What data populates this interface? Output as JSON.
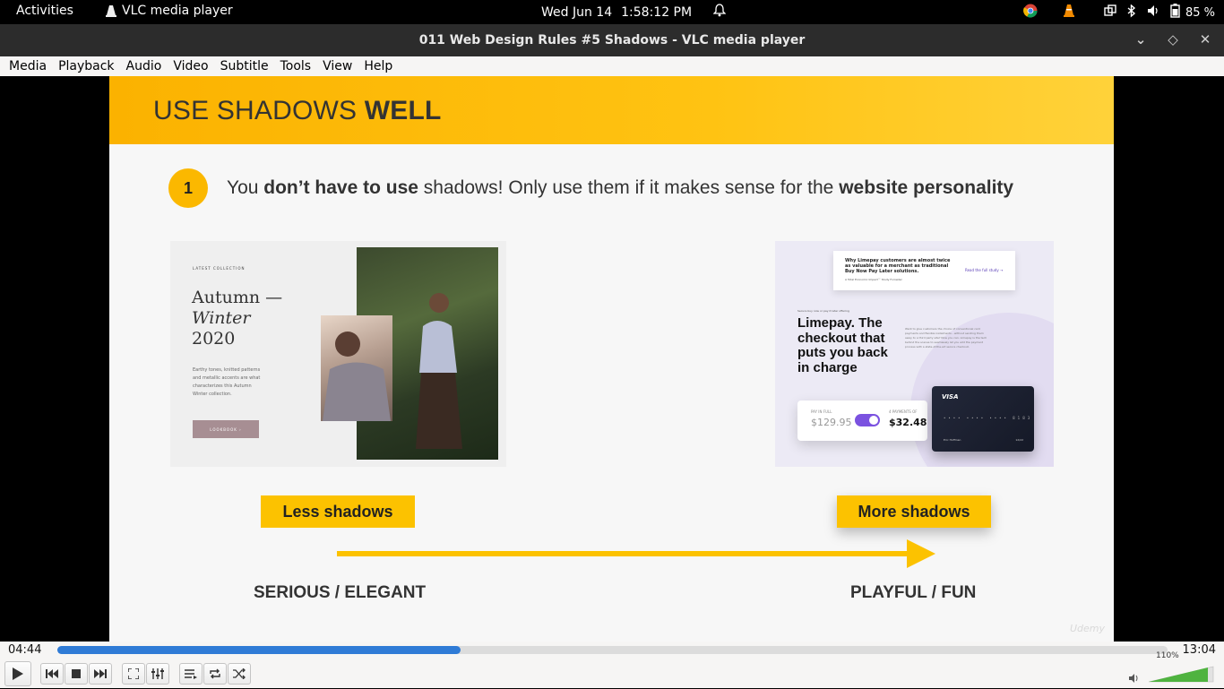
{
  "topbar": {
    "activities": "Activities",
    "app_name": "VLC media player",
    "date": "Wed Jun 14",
    "time": "1:58:12 PM",
    "battery": "85 %"
  },
  "window": {
    "title": "011 Web Design Rules #5 Shadows - VLC media player"
  },
  "menu": {
    "items": [
      "Media",
      "Playback",
      "Audio",
      "Video",
      "Subtitle",
      "Tools",
      "View",
      "Help"
    ]
  },
  "slide": {
    "title_normal": "USE SHADOWS ",
    "title_bold": "WELL",
    "point_number": "1",
    "point_text_1": "You ",
    "point_text_2": "don’t have to use",
    "point_text_3": " shadows! Only use them if it makes sense for the ",
    "point_text_4": "website personality",
    "left_thumb": {
      "kicker": "LATEST COLLECTION",
      "line1": "Autumn —",
      "line2": "Winter",
      "line3": "2020",
      "desc": "Earthy tones, knitted patterns and metallic accents are what characterizes this Autumn Winter collection.",
      "button": "LOOKBOOK ›"
    },
    "right_thumb": {
      "quote": "Why Limepay customers are almost twice as valuable for a merchant as traditional Buy Now Pay Later solutions.",
      "quote_source": "A Total Economic Impact™ Study Forrester",
      "quote_link": "Read the full study →",
      "tag": "Secure buy now or pay it later offering",
      "headline": "Limepay. The checkout that puts you back in charge",
      "body": "Want to give customers the choice of conventional card payments and flexible instalments - without sending them away to a third party site? Now you can. Limepay is the tech behind the scenes to seamlessly let you add the payment process with a state-of-the-art secure checkout.",
      "pay_full_label": "PAY IN FULL",
      "pay_full_value": "$129.95",
      "payments_label": "4 PAYMENTS OF",
      "payments_value": "$32.48",
      "card_brand": "VISA",
      "card_digits": "•••• •••• •••• 8183",
      "card_holder": "Eric Hoffman",
      "card_exp": "12/22"
    },
    "less_label": "Less shadows",
    "more_label": "More shadows",
    "scale_left": "SERIOUS / ELEGANT",
    "scale_right": "PLAYFUL / FUN",
    "watermark": "Udemy"
  },
  "player": {
    "elapsed": "04:44",
    "total": "13:04",
    "progress": 0.363,
    "volume": "110%"
  }
}
